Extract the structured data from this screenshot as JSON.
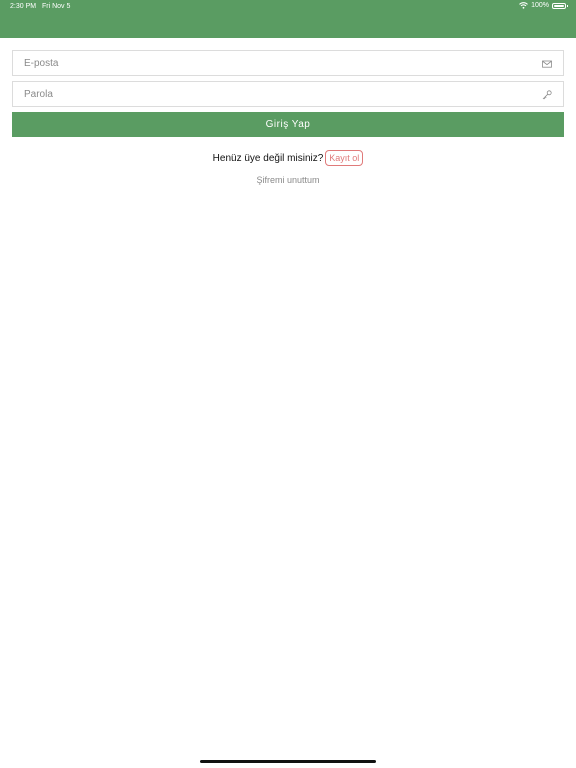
{
  "status_bar": {
    "time": "2:30 PM",
    "date": "Fri Nov 5",
    "battery": "100%"
  },
  "form": {
    "email": {
      "value": "",
      "placeholder": "E-posta",
      "icon": "mail-icon"
    },
    "password": {
      "value": "",
      "placeholder": "Parola",
      "icon": "key-icon"
    },
    "login_label": "Giriş Yap"
  },
  "signup": {
    "question": "Henüz üye değil misiniz?",
    "link_label": "Kayıt ol"
  },
  "forgot_password": "Şifremi unuttum",
  "colors": {
    "primary": "#5a9c62",
    "signup_link": "#e07a7a",
    "muted_text": "#8a8a8a",
    "field_border": "#dcdcdc"
  }
}
